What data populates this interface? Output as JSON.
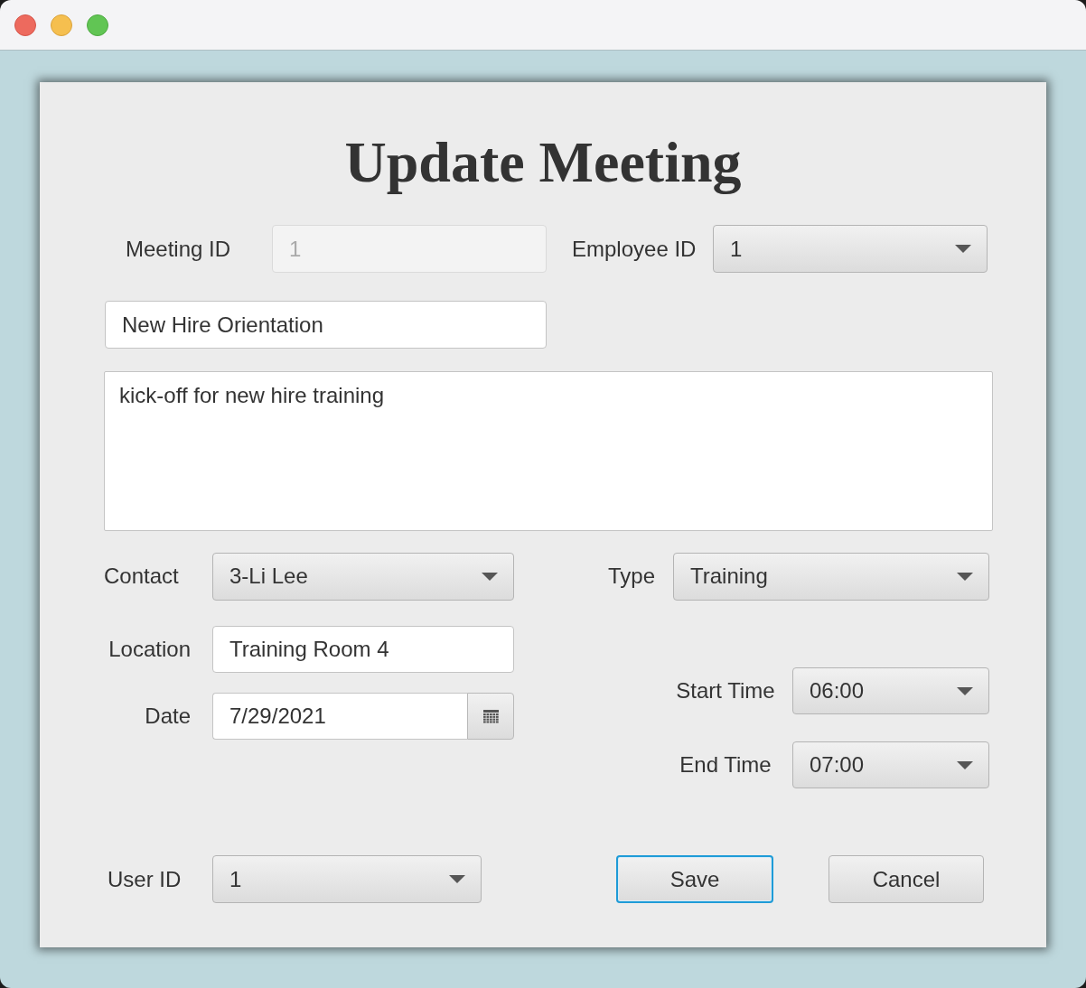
{
  "form": {
    "heading": "Update Meeting",
    "meeting_id": {
      "label": "Meeting ID",
      "value": "1",
      "disabled": true
    },
    "employee_id": {
      "label": "Employee ID",
      "value": "1"
    },
    "text_field": {
      "value": "New Hire Orientation"
    },
    "text_area": {
      "value": "kick-off for new hire training"
    },
    "contact": {
      "label": "Contact",
      "value": "3-Li Lee"
    },
    "type": {
      "label": "Type",
      "value": "Training"
    },
    "location": {
      "label": "Location",
      "value": "Training Room 4"
    },
    "date": {
      "label": "Date",
      "value": "7/29/2021"
    },
    "start_time": {
      "label": "Start Time",
      "value": "06:00"
    },
    "end_time": {
      "label": "End Time",
      "value": "07:00"
    },
    "user_id": {
      "label": "User ID",
      "value": "1"
    },
    "buttons": [
      {
        "label": "Save",
        "focused": true
      },
      {
        "label": "Cancel",
        "focused": false
      }
    ]
  }
}
